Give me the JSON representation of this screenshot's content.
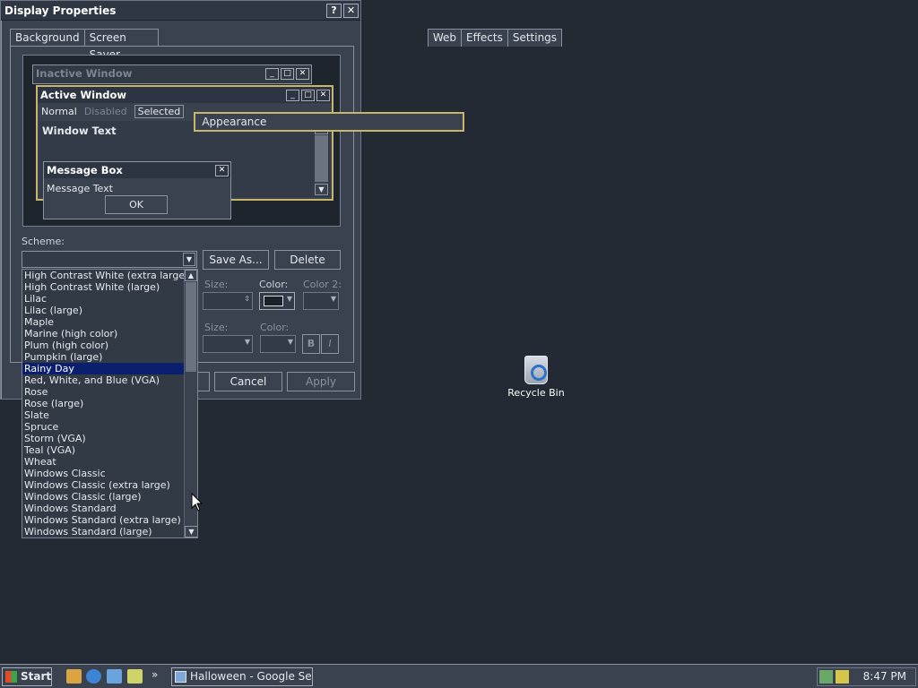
{
  "dialog": {
    "title": "Display Properties",
    "help_btn": "?",
    "close_btn": "✕",
    "tabs": [
      "Background",
      "Screen Saver",
      "Appearance",
      "Web",
      "Effects",
      "Settings"
    ],
    "active_tab": "Appearance"
  },
  "preview": {
    "inactive_title": "Inactive Window",
    "active_title": "Active Window",
    "menu_normal": "Normal",
    "menu_disabled": "Disabled",
    "menu_selected": "Selected",
    "window_text": "Window Text",
    "msgbox_title": "Message Box",
    "msgbox_text": "Message Text",
    "ok": "OK"
  },
  "scheme": {
    "label": "Scheme:",
    "value": "",
    "save_as": "Save As...",
    "delete": "Delete"
  },
  "item_row": {
    "size_label": "Size:",
    "color_label": "Color:",
    "color2_label": "Color 2:"
  },
  "font_row": {
    "size_label": "Size:",
    "color_label": "Color:",
    "bold": "B",
    "italic": "I"
  },
  "footer": {
    "cancel": "Cancel",
    "apply": "Apply"
  },
  "scheme_list": {
    "items": [
      "High Contrast White (extra large)",
      "High Contrast White (large)",
      "Lilac",
      "Lilac (large)",
      "Maple",
      "Marine (high color)",
      "Plum (high color)",
      "Pumpkin (large)",
      "Rainy Day",
      "Red, White, and Blue (VGA)",
      "Rose",
      "Rose (large)",
      "Slate",
      "Spruce",
      "Storm (VGA)",
      "Teal (VGA)",
      "Wheat",
      "Windows Classic",
      "Windows Classic (extra large)",
      "Windows Classic (large)",
      "Windows Standard",
      "Windows Standard (extra large)",
      "Windows Standard (large)"
    ],
    "selected": "Rainy Day"
  },
  "desktop": {
    "recycle_bin_label": "Recycle Bin"
  },
  "taskbar": {
    "start_label": "Start",
    "chevron": "»",
    "task_label": "Halloween - Google Searc...",
    "clock": "8:47 PM"
  },
  "colors": {
    "desktop": "#232a33",
    "window": "#3a4250",
    "selection": "#0a1f6e",
    "active_border": "#c8b76a"
  }
}
